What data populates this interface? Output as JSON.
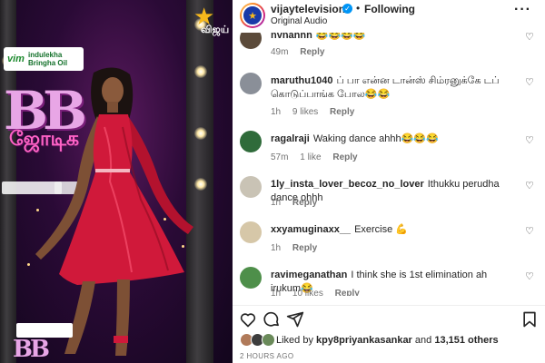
{
  "media": {
    "channel_logo_text": "விஜய்",
    "show_logo": "BB",
    "show_logo_sub": "ஜோடிக",
    "sponsor_brand": "vim",
    "sponsor_text": "indulekha Bringha Oil"
  },
  "header": {
    "username": "vijaytelevision",
    "follow_dot": "•",
    "follow_status": "Following",
    "audio": "Original Audio",
    "more_icon": "more-options-icon"
  },
  "comments": [
    {
      "username": "nvnahhh",
      "text": "😂😂😂😂",
      "time": "49m",
      "likes": "",
      "reply": "Reply",
      "avatar_color": "#5b4a3a"
    },
    {
      "username": "maruthu1040",
      "text": "ப் பா என்ன டான்ஸ் சிம்ரனுக்கே டப் கொடுப்பாங்க போல😂😂",
      "time": "1h",
      "likes": "9 likes",
      "reply": "Reply",
      "avatar_color": "#8a8f98"
    },
    {
      "username": "ragalraji",
      "text": "Waking dance ahhh😂😂😂",
      "time": "57m",
      "likes": "1 like",
      "reply": "Reply",
      "avatar_color": "#2f6b3a"
    },
    {
      "username": "1ly_insta_lover_becoz_no_lover",
      "text": "Ithukku perudha dance ohhh",
      "time": "1h",
      "likes": "",
      "reply": "Reply",
      "avatar_color": "#c9c3b5"
    },
    {
      "username": "xxyamuginaxx__",
      "text": "Exercise 💪",
      "time": "1h",
      "likes": "",
      "reply": "Reply",
      "avatar_color": "#d6c7a8"
    },
    {
      "username": "ravimeganathan",
      "text": "I think she is 1st elimination ah irukum😂",
      "time": "1h",
      "likes": "10 likes",
      "reply": "Reply",
      "avatar_color": "#4e8f4a"
    }
  ],
  "actions": {
    "like_icon": "heart-icon",
    "comment_icon": "comment-icon",
    "share_icon": "share-icon",
    "save_icon": "bookmark-icon"
  },
  "likes": {
    "prefix": "Liked by",
    "user": "kpy8priyankasankar",
    "middle": "and",
    "others": "13,151 others"
  },
  "timestamp": "2 HOURS AGO",
  "colors": {
    "dress": "#d0193a",
    "verified": "#0095f6",
    "muted_text": "#737373"
  }
}
